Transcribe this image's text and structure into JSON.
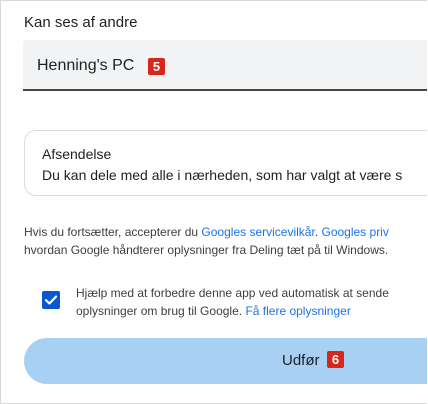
{
  "visibility": {
    "label": "Kan ses af andre",
    "device_name": "Henning's PC",
    "device_name_badge": "5"
  },
  "sending": {
    "title": "Afsendelse",
    "description": "Du kan dele med alle i nærheden, som har valgt at være s"
  },
  "terms": {
    "prefix": "Hvis du fortsætter, accepterer du ",
    "tos_link": "Googles servicevilkår",
    "sep": ". ",
    "privacy_link": "Googles priv",
    "line2": "hvordan Google håndterer oplysninger fra Deling tæt på til Windows."
  },
  "consent": {
    "checked": true,
    "line1": "Hjælp med at forbedre denne app ved automatisk at sende",
    "line2_prefix": "oplysninger om brug til Google. ",
    "learn_more": "Få flere oplysninger"
  },
  "submit": {
    "label": "Udfør",
    "badge": "6"
  },
  "colors": {
    "accent": "#0b57d0",
    "link": "#1a73e8",
    "button_bg": "#a8d0f2",
    "badge": "#d9261c"
  }
}
